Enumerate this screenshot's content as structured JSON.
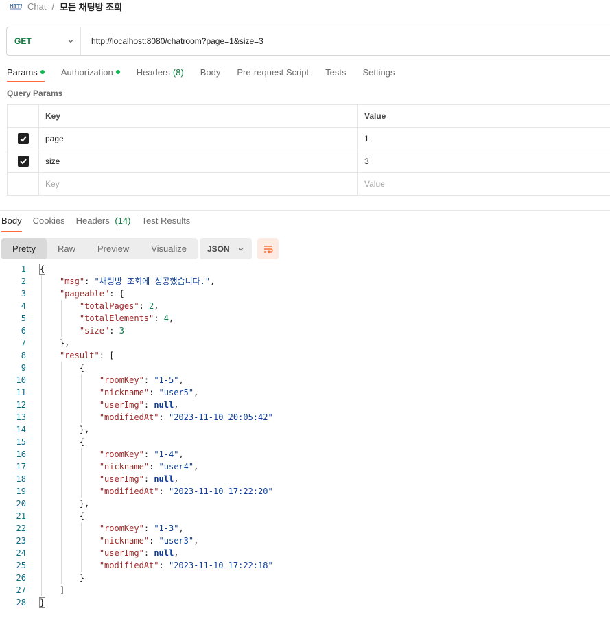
{
  "breadcrumb": {
    "parent": "Chat",
    "separator": "/",
    "current": "모든 채팅방 조회"
  },
  "request": {
    "method": "GET",
    "url": "http://localhost:8080/chatroom?page=1&size=3"
  },
  "request_tabs": [
    {
      "label": "Params",
      "dot": true
    },
    {
      "label": "Authorization",
      "dot": true
    },
    {
      "label": "Headers",
      "count": "(8)"
    },
    {
      "label": "Body"
    },
    {
      "label": "Pre-request Script"
    },
    {
      "label": "Tests"
    },
    {
      "label": "Settings"
    }
  ],
  "query_params": {
    "title": "Query Params",
    "columns": {
      "key": "Key",
      "value": "Value"
    },
    "rows": [
      {
        "key": "page",
        "value": "1",
        "checked": true
      },
      {
        "key": "size",
        "value": "3",
        "checked": true
      }
    ],
    "placeholder": {
      "key": "Key",
      "value": "Value"
    }
  },
  "response_tabs": [
    {
      "label": "Body"
    },
    {
      "label": "Cookies"
    },
    {
      "label": "Headers",
      "count": "(14)"
    },
    {
      "label": "Test Results"
    }
  ],
  "view_modes": [
    "Pretty",
    "Raw",
    "Preview",
    "Visualize"
  ],
  "format": "JSON",
  "colors": {
    "accent": "#ff6c37",
    "method": "#0f7b3f",
    "key": "#a12a2a",
    "string": "#0e3f9a",
    "number": "#137a4f"
  },
  "code_lines": [
    "{",
    "    \"msg\": \"채팅방 조회에 성공했습니다.\",",
    "    \"pageable\": {",
    "        \"totalPages\": 2,",
    "        \"totalElements\": 4,",
    "        \"size\": 3",
    "    },",
    "    \"result\": [",
    "        {",
    "            \"roomKey\": \"1-5\",",
    "            \"nickname\": \"user5\",",
    "            \"userImg\": null,",
    "            \"modifiedAt\": \"2023-11-10 20:05:42\"",
    "        },",
    "        {",
    "            \"roomKey\": \"1-4\",",
    "            \"nickname\": \"user4\",",
    "            \"userImg\": null,",
    "            \"modifiedAt\": \"2023-11-10 17:22:20\"",
    "        },",
    "        {",
    "            \"roomKey\": \"1-3\",",
    "            \"nickname\": \"user3\",",
    "            \"userImg\": null,",
    "            \"modifiedAt\": \"2023-11-10 17:22:18\"",
    "        }",
    "    ]",
    "}"
  ]
}
